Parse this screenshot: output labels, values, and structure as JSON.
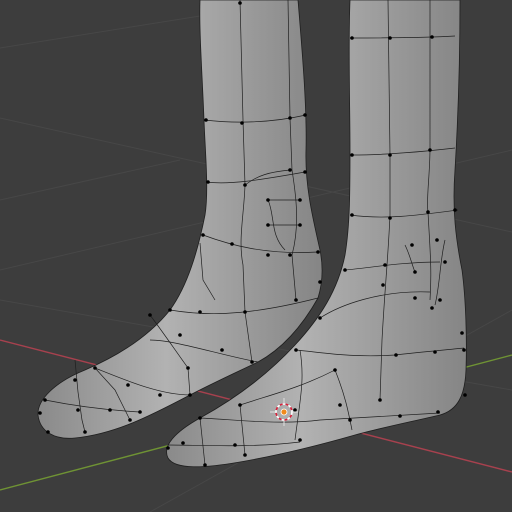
{
  "app": "3D viewport",
  "viewport": {
    "mode": "edit-mesh",
    "grid_visible": true,
    "axes_visible": [
      "x",
      "y"
    ],
    "object": "leg-and-foot-mesh",
    "selection": "all-vertices",
    "pivot_gizmo": "3d-cursor"
  },
  "colors": {
    "background": "#3d3d3d",
    "grid_line": "#474747",
    "x_axis": "#a7414e",
    "y_axis": "#6f9334",
    "mesh_fill": "#9f9f9f",
    "wire": "#1f1f1f",
    "vertex": "#000000",
    "cursor_red": "#d8203a",
    "cursor_white": "#ffffff",
    "origin": "#f08a1c"
  },
  "icons": {
    "cursor": "3d-cursor-icon",
    "origin": "object-origin-dot"
  }
}
